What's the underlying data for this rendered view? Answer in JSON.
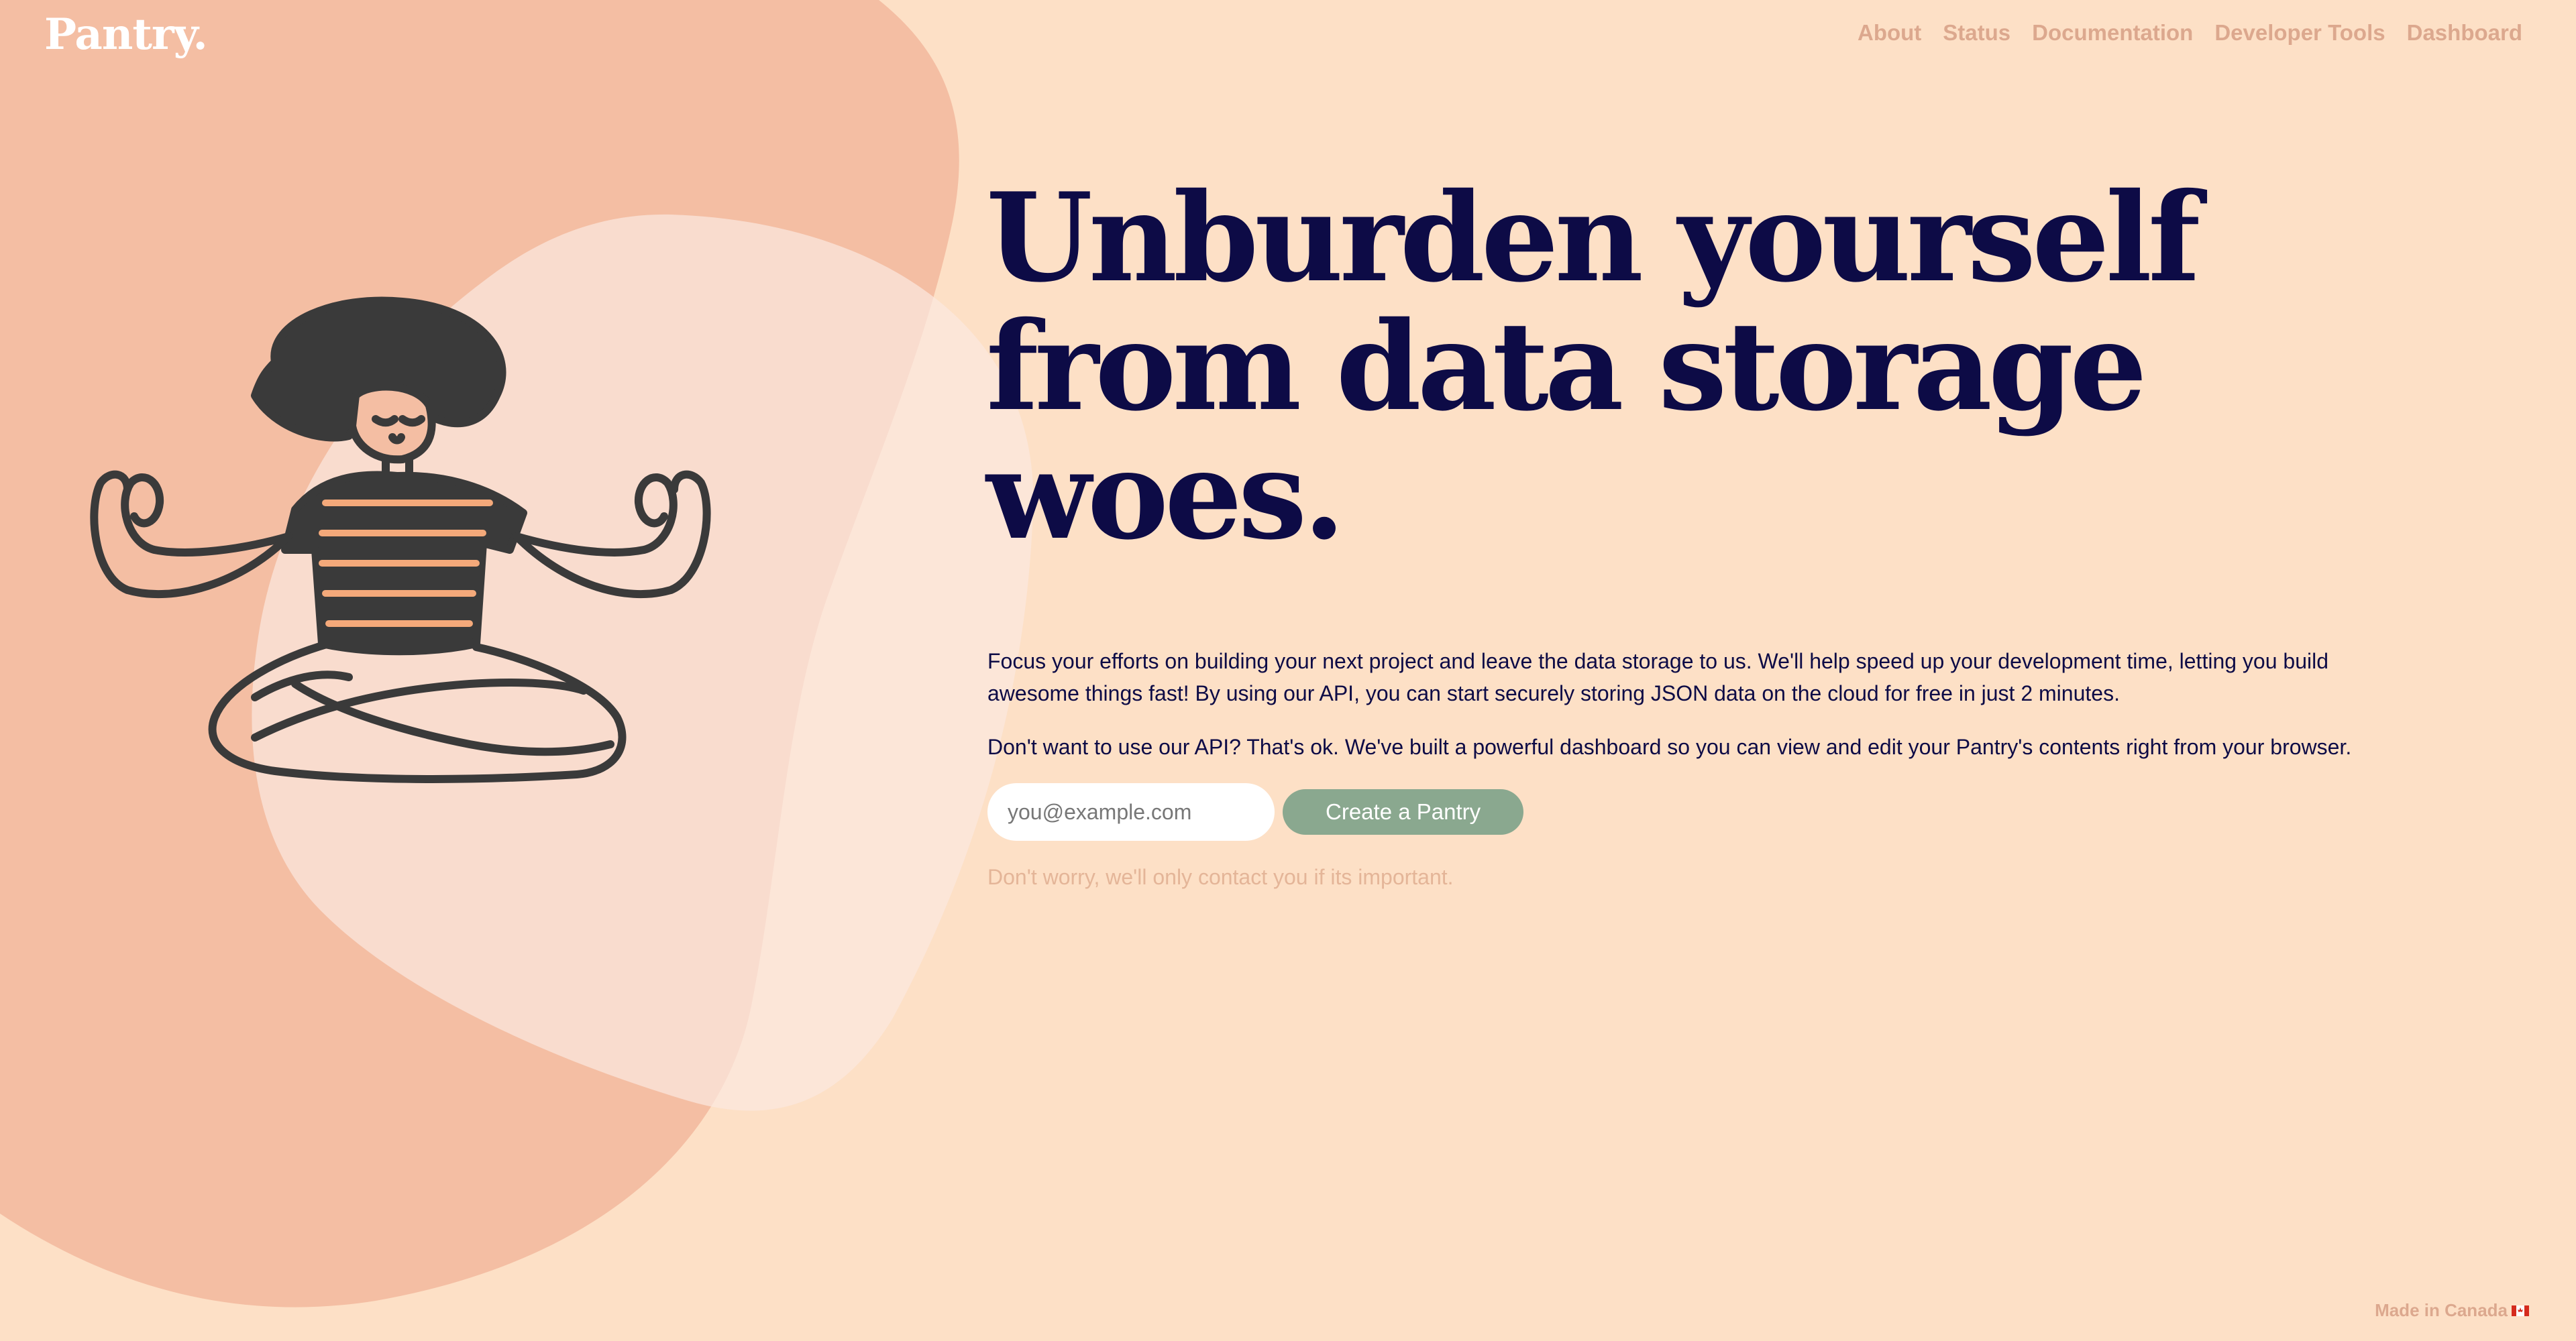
{
  "header": {
    "logo": "Pantry.",
    "nav": [
      "About",
      "Status",
      "Documentation",
      "Developer Tools",
      "Dashboard"
    ]
  },
  "hero": {
    "headline": "Unburden yourself from data storage woes.",
    "paragraph1": "Focus your efforts on building your next project and leave the data storage to us. We'll help speed up your development time, letting you build awesome things fast! By using our API, you can start securely storing JSON data on the cloud for free in just 2 minutes.",
    "paragraph2": "Don't want to use our API? That's ok. We've built a powerful dashboard so you can view and edit your Pantry's contents right from your browser.",
    "email_placeholder": "you@example.com",
    "cta_label": "Create a Pantry",
    "note": "Don't worry, we'll only contact you if its important."
  },
  "footer": {
    "made_in": "Made in Canada"
  },
  "colors": {
    "background": "#fde0c6",
    "blob_primary": "#f4bea3",
    "blob_secondary": "#fae6dd",
    "headline": "#0d0b46",
    "nav": "#dca88e",
    "button": "#8aa88f",
    "note": "#e4b598"
  },
  "icons": {
    "illustration": "meditating-person-illustration",
    "flag": "canada-flag-icon"
  }
}
